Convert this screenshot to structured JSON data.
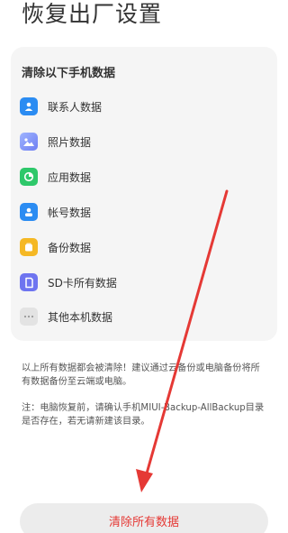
{
  "page": {
    "title": "恢复出厂设置"
  },
  "card": {
    "title": "清除以下手机数据",
    "items": [
      {
        "label": "联系人数据",
        "icon": "contacts-icon",
        "color": "#2b8cf2"
      },
      {
        "label": "照片数据",
        "icon": "photos-icon",
        "color": "#7e8ef8"
      },
      {
        "label": "应用数据",
        "icon": "apps-icon",
        "color": "#2ec86a"
      },
      {
        "label": "帐号数据",
        "icon": "account-icon",
        "color": "#2b8cf2"
      },
      {
        "label": "备份数据",
        "icon": "backup-icon",
        "color": "#f5b824"
      },
      {
        "label": "SD卡所有数据",
        "icon": "sd-card-icon",
        "color": "#6e74f0"
      },
      {
        "label": "其他本机数据",
        "icon": "more-icon",
        "color": "#e3e3e3"
      }
    ]
  },
  "notices": {
    "warning": "以上所有数据都会被清除！建议通过云备份或电脑备份将所有数据备份至云端或电脑。",
    "note": "注：电脑恢复前，请确认手机MIUI-Backup-AllBackup目录是否存在，若无请新建该目录。"
  },
  "action": {
    "clear_label": "清除所有数据",
    "color": "#e53935"
  },
  "annotation": {
    "arrow_color": "#e53935"
  }
}
